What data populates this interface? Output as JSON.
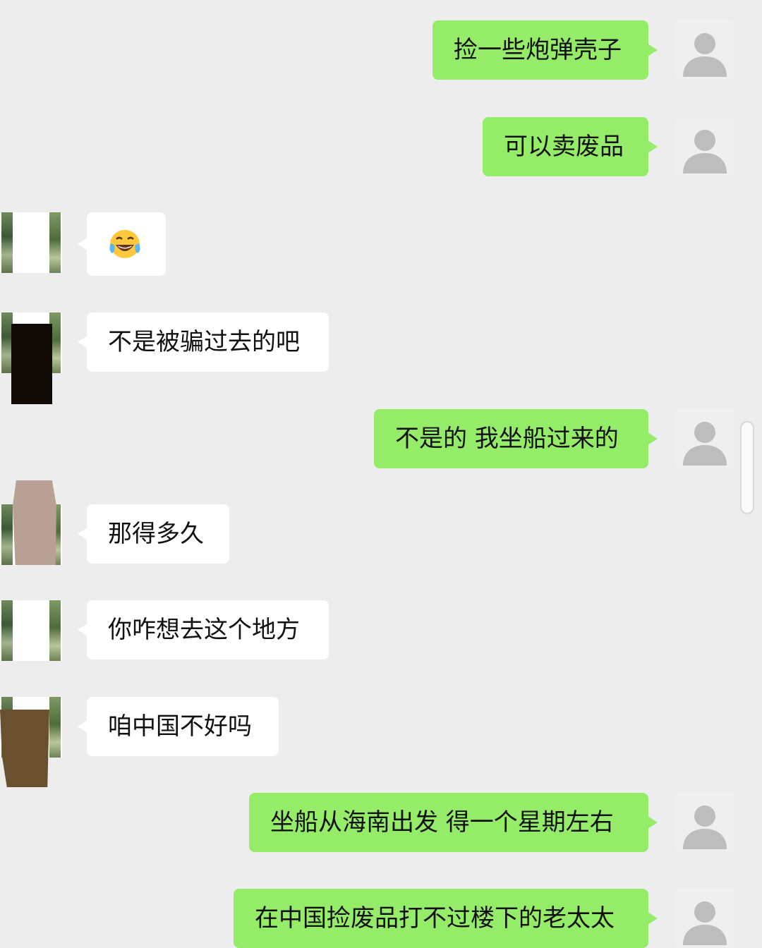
{
  "conversation": {
    "messages": [
      {
        "side": "me",
        "text": "捡一些炮弹壳子"
      },
      {
        "side": "me",
        "text": "可以卖废品"
      },
      {
        "side": "other",
        "type": "emoji",
        "icon": "tears-of-joy-emoji"
      },
      {
        "side": "other",
        "text": "不是被骗过去的吧"
      },
      {
        "side": "me",
        "text": "不是的 我坐船过来的"
      },
      {
        "side": "other",
        "text": "那得多久"
      },
      {
        "side": "other",
        "text": "你咋想去这个地方"
      },
      {
        "side": "other",
        "text": "咱中国不好吗"
      },
      {
        "side": "me",
        "text": "坐船从海南出发 得一个星期左右"
      },
      {
        "side": "me",
        "text": "在中国捡废品打不过楼下的老太太"
      }
    ]
  },
  "colors": {
    "background": "#EDEDED",
    "outgoing_bubble": "#95EC69",
    "incoming_bubble": "#FFFFFF",
    "redaction_black": "#120A06",
    "redaction_pink": "#B9A095",
    "redaction_brown": "#6B5030"
  },
  "icons": {
    "own_avatar": "default-user-avatar-icon",
    "other_avatar": "redacted-photo-avatar"
  }
}
